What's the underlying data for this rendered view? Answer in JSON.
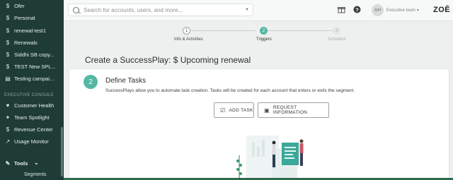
{
  "sidebar": {
    "items": [
      {
        "icon": "$",
        "label": "Ofer"
      },
      {
        "icon": "$",
        "label": "Personal"
      },
      {
        "icon": "$",
        "label": "renewal-test1"
      },
      {
        "icon": "$",
        "label": "Renewals"
      },
      {
        "icon": "$",
        "label": "Siddhi SB copy..."
      },
      {
        "icon": "$",
        "label": "TEST New SPL..."
      },
      {
        "icon": "▤",
        "label": "Testing campai..."
      }
    ],
    "section_title": "EXECUTIVE CONSOLE",
    "console_items": [
      {
        "icon": "♥",
        "label": "Customer Health"
      },
      {
        "icon": "✦",
        "label": "Team Spotlight"
      },
      {
        "icon": "$",
        "label": "Revenue Center"
      },
      {
        "icon": "↗",
        "label": "Usage Monitor"
      }
    ],
    "tools": {
      "icon": "✎",
      "label": "Tools",
      "chevron": "⌄"
    },
    "sub_item": "Segments"
  },
  "topbar": {
    "search_placeholder": "Search for accounts, users, and more...",
    "avatar_initials": "AH",
    "team_label": "Executive team",
    "team_chevron": "▾",
    "logo": "ZOĒ"
  },
  "stepper": {
    "steps": [
      {
        "number": "1",
        "label": "Info & Activities",
        "state": "complete"
      },
      {
        "number": "2",
        "label": "Triggers",
        "state": "active"
      },
      {
        "number": "3",
        "label": "Activation",
        "state": "upcoming"
      }
    ]
  },
  "page": {
    "title": "Create a SuccessPlay: $ Upcoming renewal"
  },
  "card": {
    "number": "2",
    "title": "Define Tasks",
    "description": "SuccessPlays allow you to automate task creation. Tasks will be created for each account that enters or exits the segment.",
    "add_task": "ADD TASK",
    "request_info": "REQUEST INFORMATION"
  },
  "colors": {
    "sidebar_bg": "#1e3b36",
    "accent": "#55b8a3"
  }
}
